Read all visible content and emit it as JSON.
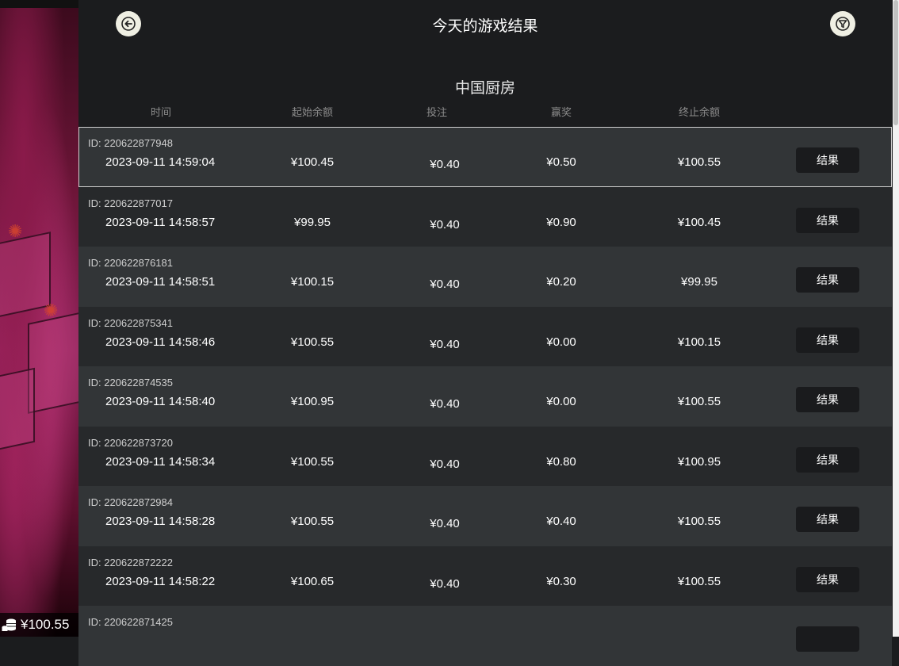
{
  "header": {
    "title": "今天的游戏结果",
    "back_icon": "arrow-left-icon",
    "filter_icon": "filter-icon"
  },
  "game_name": "中国厨房",
  "columns": {
    "time": "时间",
    "start_balance": "起始余额",
    "bet": "投注",
    "win": "赢奖",
    "end_balance": "终止余额"
  },
  "rows": [
    {
      "id": "ID:  220622877948",
      "time": "2023-09-11 14:59:04",
      "start": "¥100.45",
      "bet": "¥0.40",
      "win": "¥0.50",
      "end": "¥100.55",
      "button": "结果"
    },
    {
      "id": "ID:  220622877017",
      "time": "2023-09-11 14:58:57",
      "start": "¥99.95",
      "bet": "¥0.40",
      "win": "¥0.90",
      "end": "¥100.45",
      "button": "结果"
    },
    {
      "id": "ID:  220622876181",
      "time": "2023-09-11 14:58:51",
      "start": "¥100.15",
      "bet": "¥0.40",
      "win": "¥0.20",
      "end": "¥99.95",
      "button": "结果"
    },
    {
      "id": "ID:  220622875341",
      "time": "2023-09-11 14:58:46",
      "start": "¥100.55",
      "bet": "¥0.40",
      "win": "¥0.00",
      "end": "¥100.15",
      "button": "结果"
    },
    {
      "id": "ID:  220622874535",
      "time": "2023-09-11 14:58:40",
      "start": "¥100.95",
      "bet": "¥0.40",
      "win": "¥0.00",
      "end": "¥100.55",
      "button": "结果"
    },
    {
      "id": "ID:  220622873720",
      "time": "2023-09-11 14:58:34",
      "start": "¥100.55",
      "bet": "¥0.40",
      "win": "¥0.80",
      "end": "¥100.95",
      "button": "结果"
    },
    {
      "id": "ID:  220622872984",
      "time": "2023-09-11 14:58:28",
      "start": "¥100.55",
      "bet": "¥0.40",
      "win": "¥0.40",
      "end": "¥100.55",
      "button": "结果"
    },
    {
      "id": "ID:  220622872222",
      "time": "2023-09-11 14:58:22",
      "start": "¥100.65",
      "bet": "¥0.40",
      "win": "¥0.30",
      "end": "¥100.55",
      "button": "结果"
    },
    {
      "id": "ID:  220622871425",
      "time": "",
      "start": "",
      "bet": "",
      "win": "",
      "end": "",
      "button": ""
    }
  ],
  "balance": {
    "value": "¥100.55",
    "icon": "coin-stack-icon"
  },
  "colors": {
    "panel_bg": "#1b1c1e",
    "row_light": "#323537",
    "row_dark": "#27292b",
    "button_bg": "#1a1b1d",
    "round_button": "#efefe3"
  }
}
